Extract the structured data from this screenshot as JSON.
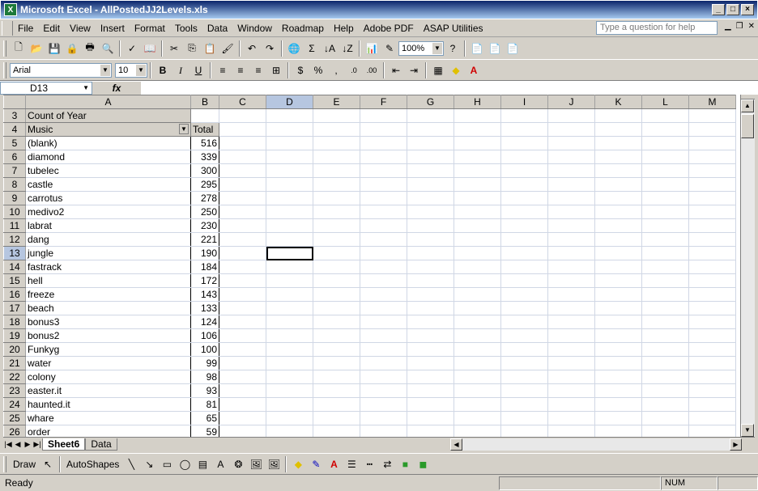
{
  "window": {
    "title": "Microsoft Excel - AllPostedJJ2Levels.xls",
    "app_icon": "X",
    "minimize": "_",
    "maximize": "□",
    "close": "×"
  },
  "menu": {
    "items": [
      "File",
      "Edit",
      "View",
      "Insert",
      "Format",
      "Tools",
      "Data",
      "Window",
      "Roadmap",
      "Help",
      "Adobe PDF",
      "ASAP Utilities"
    ],
    "help_placeholder": "Type a question for help"
  },
  "toolbar": {
    "zoom": "100%",
    "font": "Arial",
    "font_size": "10",
    "bold": "B",
    "italic": "I",
    "underline": "U",
    "currency": "$",
    "percent": "%",
    "comma": ",",
    "sum": "Σ"
  },
  "formula_bar": {
    "name_box": "D13",
    "fx": "fx",
    "formula": ""
  },
  "columns": [
    "A",
    "B",
    "C",
    "D",
    "E",
    "F",
    "G",
    "H",
    "I",
    "J",
    "K",
    "L",
    "M"
  ],
  "pivot": {
    "header_row": "3",
    "header_label": "Count of Year",
    "field_row": "4",
    "field_label": "Music",
    "total_label": "Total",
    "rows": [
      {
        "row": "5",
        "music": "(blank)",
        "total": "516"
      },
      {
        "row": "6",
        "music": "diamond",
        "total": "339"
      },
      {
        "row": "7",
        "music": "tubelec",
        "total": "300"
      },
      {
        "row": "8",
        "music": "castle",
        "total": "295"
      },
      {
        "row": "9",
        "music": "carrotus",
        "total": "278"
      },
      {
        "row": "10",
        "music": "medivo2",
        "total": "250"
      },
      {
        "row": "11",
        "music": "labrat",
        "total": "230"
      },
      {
        "row": "12",
        "music": "dang",
        "total": "221"
      },
      {
        "row": "13",
        "music": "jungle",
        "total": "190"
      },
      {
        "row": "14",
        "music": "fastrack",
        "total": "184"
      },
      {
        "row": "15",
        "music": "hell",
        "total": "172"
      },
      {
        "row": "16",
        "music": "freeze",
        "total": "143"
      },
      {
        "row": "17",
        "music": "beach",
        "total": "133"
      },
      {
        "row": "18",
        "music": "bonus3",
        "total": "124"
      },
      {
        "row": "19",
        "music": "bonus2",
        "total": "106"
      },
      {
        "row": "20",
        "music": "Funkyg",
        "total": "100"
      },
      {
        "row": "21",
        "music": "water",
        "total": "99"
      },
      {
        "row": "22",
        "music": "colony",
        "total": "98"
      },
      {
        "row": "23",
        "music": "easter.it",
        "total": "93"
      },
      {
        "row": "24",
        "music": "haunted.it",
        "total": "81"
      },
      {
        "row": "25",
        "music": "whare",
        "total": "65"
      },
      {
        "row": "26",
        "music": "order",
        "total": "59"
      }
    ]
  },
  "sheets": {
    "tabs": [
      "Sheet6",
      "Data"
    ],
    "active": "Sheet6"
  },
  "drawing": {
    "draw": "Draw",
    "autoshapes": "AutoShapes"
  },
  "status": {
    "ready": "Ready",
    "num": "NUM"
  },
  "colors": {
    "titlebar": "#0a246a",
    "face": "#d4d0c8",
    "selected_col": "#b6c6e0"
  }
}
